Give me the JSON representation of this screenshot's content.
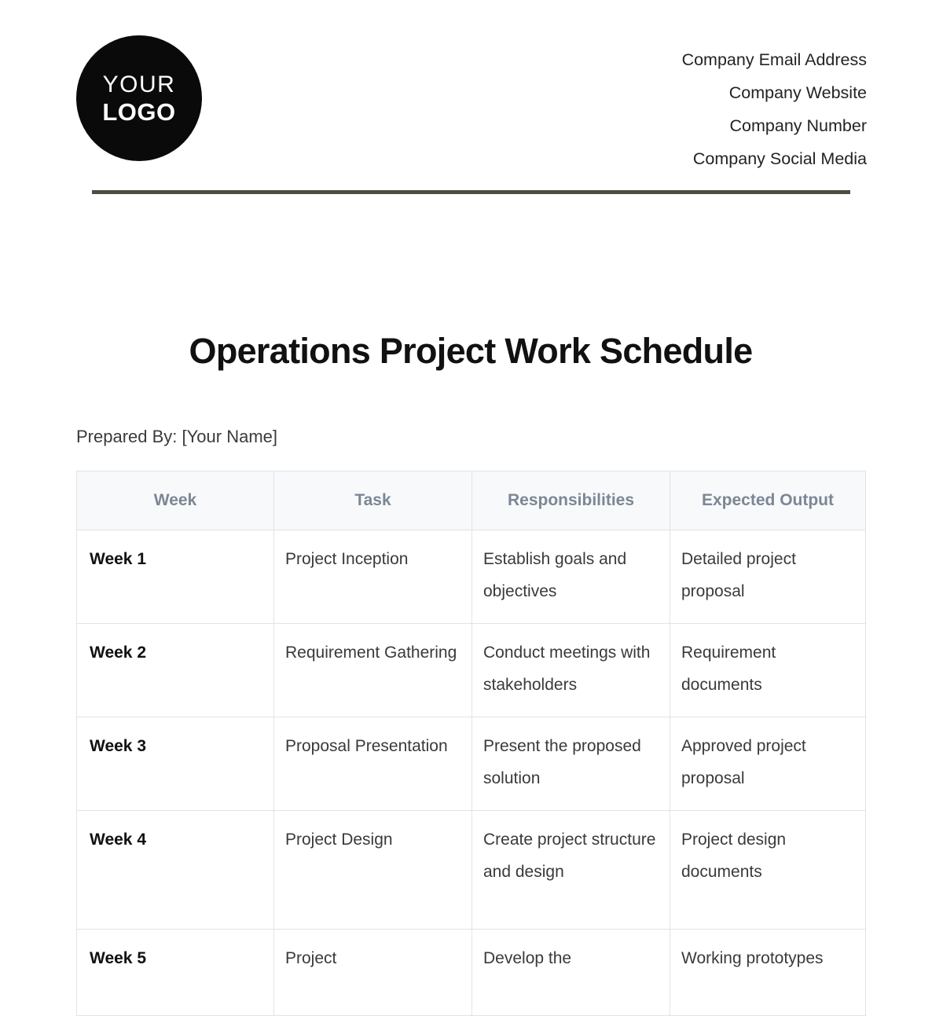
{
  "letterhead": {
    "logo": {
      "line1": "YOUR",
      "line2": "LOGO"
    },
    "contacts": [
      "Company Email Address",
      "Company Website",
      "Company Number",
      "Company Social Media"
    ]
  },
  "document": {
    "title": "Operations Project Work Schedule",
    "prepared_by": "Prepared By: [Your Name]"
  },
  "table": {
    "headers": [
      "Week",
      "Task",
      "Responsibilities",
      "Expected Output"
    ],
    "rows": [
      {
        "week": "Week 1",
        "task": "Project Inception",
        "responsibilities": "Establish goals and objectives",
        "expected_output": "Detailed project proposal"
      },
      {
        "week": "Week 2",
        "task": "Requirement Gathering",
        "responsibilities": "Conduct meetings with stakeholders",
        "expected_output": "Requirement documents"
      },
      {
        "week": "Week 3",
        "task": "Proposal Presentation",
        "responsibilities": "Present the proposed solution",
        "expected_output": "Approved project proposal"
      },
      {
        "week": "Week 4",
        "task": "Project Design",
        "responsibilities": "Create project structure and design",
        "expected_output": "Project design documents"
      },
      {
        "week": "Week 5",
        "task": "Project",
        "responsibilities": "Develop the",
        "expected_output": "Working prototypes"
      }
    ]
  },
  "colors": {
    "header_rule": "#4d4d40",
    "logo_background": "#0a0a0a",
    "table_header_text": "#7c8794",
    "table_header_background": "#f7f9fb",
    "table_border": "#dfe3e8"
  }
}
